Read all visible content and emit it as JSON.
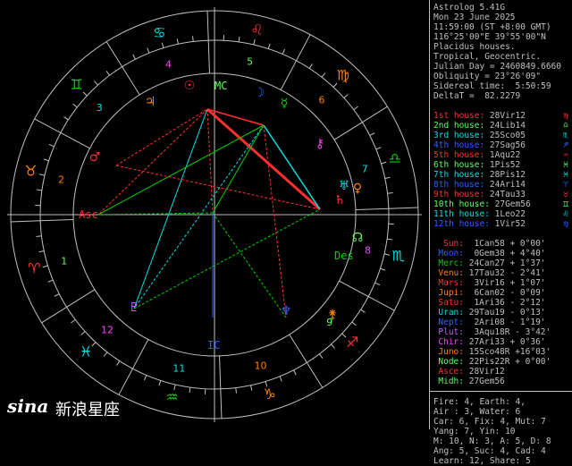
{
  "colors": {
    "red": "#ff3030",
    "green": "#00d000",
    "lightgreen": "#60ff60",
    "cyan": "#00e0e0",
    "blue": "#3060ff",
    "orange": "#ff8000",
    "yellow": "#ffff40",
    "magenta": "#ff40ff",
    "violet": "#c060ff",
    "gray": "#c0c0c0",
    "white": "#ffffff"
  },
  "header": [
    "Astrolog 5.41G",
    "Mon 23 June 2025",
    "11:59:00 (ST +8:00 GMT)",
    "116°25'00\"E 39°55'00\"N",
    "Placidus houses.",
    "Tropical, Geocentric.",
    "Julian Day = 2460849.6660",
    "Obliquity = 23°26'09\"",
    "Sidereal time:  5:50:59",
    "DeltaT =  82.2279"
  ],
  "houses": [
    {
      "label": "1st house:",
      "value": "28Vir12",
      "color": "red",
      "sign": "virgo-icon"
    },
    {
      "label": "2nd house:",
      "value": "24Lib14",
      "color": "lightgreen",
      "sign": "libra-icon"
    },
    {
      "label": "3rd house:",
      "value": "25Sco05",
      "color": "cyan",
      "sign": "scorpio-icon"
    },
    {
      "label": "4th house:",
      "value": "27Sag56",
      "color": "blue",
      "sign": "sagittarius-icon"
    },
    {
      "label": "5th house:",
      "value": "1Aqu22",
      "color": "red",
      "sign": "aquarius-icon"
    },
    {
      "label": "6th house:",
      "value": "1Pis52",
      "color": "lightgreen",
      "sign": "pisces-icon"
    },
    {
      "label": "7th house:",
      "value": "28Pis12",
      "color": "cyan",
      "sign": "pisces-icon"
    },
    {
      "label": "8th house:",
      "value": "24Ari14",
      "color": "blue",
      "sign": "aries-icon"
    },
    {
      "label": "9th house:",
      "value": "24Tau33",
      "color": "red",
      "sign": "taurus-icon"
    },
    {
      "label": "10th house:",
      "value": "27Gem56",
      "color": "lightgreen",
      "sign": "gemini-icon"
    },
    {
      "label": "11th house:",
      "value": "1Leo22",
      "color": "cyan",
      "sign": "leo-icon"
    },
    {
      "label": "12th house:",
      "value": "1Vir52",
      "color": "blue",
      "sign": "virgo-icon"
    }
  ],
  "planets": [
    {
      "name": "Sun:",
      "pos": " 1Can58",
      "aspect": "+ 0°00'",
      "color": "red"
    },
    {
      "name": "Moon:",
      "pos": " 0Gem38",
      "aspect": "+ 4°40'",
      "color": "blue"
    },
    {
      "name": "Merc:",
      "pos": "24Can27",
      "aspect": "+ 1°37'",
      "color": "green"
    },
    {
      "name": "Venu:",
      "pos": "17Tau32",
      "aspect": "- 2°41'",
      "color": "orange"
    },
    {
      "name": "Mars:",
      "pos": " 3Vir16",
      "aspect": "+ 1°07'",
      "color": "red"
    },
    {
      "name": "Jupi:",
      "pos": " 6Can02",
      "aspect": "- 0°09'",
      "color": "orange"
    },
    {
      "name": "Satu:",
      "pos": " 1Ari36",
      "aspect": "- 2°12'",
      "color": "red"
    },
    {
      "name": "Uran:",
      "pos": "29Tau19",
      "aspect": "- 0°13'",
      "color": "cyan"
    },
    {
      "name": "Nept:",
      "pos": " 2Ari08",
      "aspect": "- 1°19'",
      "color": "blue"
    },
    {
      "name": "Plut:",
      "pos": " 3Aqu18R",
      "aspect": "- 3°42'",
      "color": "violet"
    },
    {
      "name": "Chir:",
      "pos": "27Ari33",
      "aspect": "+ 0°36'",
      "color": "magenta"
    },
    {
      "name": "Juno:",
      "pos": "15Sco48R",
      "aspect": "+16°03'",
      "color": "orange"
    },
    {
      "name": "Node:",
      "pos": "22Pis22R",
      "aspect": "+ 0°00'",
      "color": "lightgreen"
    },
    {
      "name": "Asce:",
      "pos": "28Vir12",
      "aspect": "",
      "color": "red"
    },
    {
      "name": "Midh:",
      "pos": "27Gem56",
      "aspect": "",
      "color": "lightgreen"
    }
  ],
  "summary": [
    "Fire: 4, Earth: 4,",
    "Air : 3, Water: 6",
    "Car: 6, Fix: 4, Mut: 7",
    "Yang: 7, Yin: 10",
    "M: 10, N: 3, A: 5, D: 8",
    "Ang: 5, Suc: 4, Cad: 4",
    "Learn: 12, Share: 5"
  ],
  "wheel": {
    "signs": [
      "♎",
      "♍",
      "♌",
      "♋",
      "♊",
      "♉",
      "♈",
      "♓",
      "♒",
      "♑",
      "♐",
      "♏"
    ],
    "house_numbers": [
      "1",
      "2",
      "3",
      "4",
      "5",
      "6",
      "7",
      "8",
      "9",
      "10",
      "11",
      "12"
    ],
    "asc_label": "Asc",
    "mc_label": "MC",
    "ic_label": "IC",
    "des_label": "Des",
    "planet_glyphs": [
      "☉",
      "☽",
      "☿",
      "♀",
      "♂",
      "♃",
      "♄",
      "♅",
      "♆",
      "♇",
      "⚷",
      "⚵",
      "☊"
    ]
  },
  "brand": {
    "logo": "sina",
    "cn": "新浪星座"
  }
}
